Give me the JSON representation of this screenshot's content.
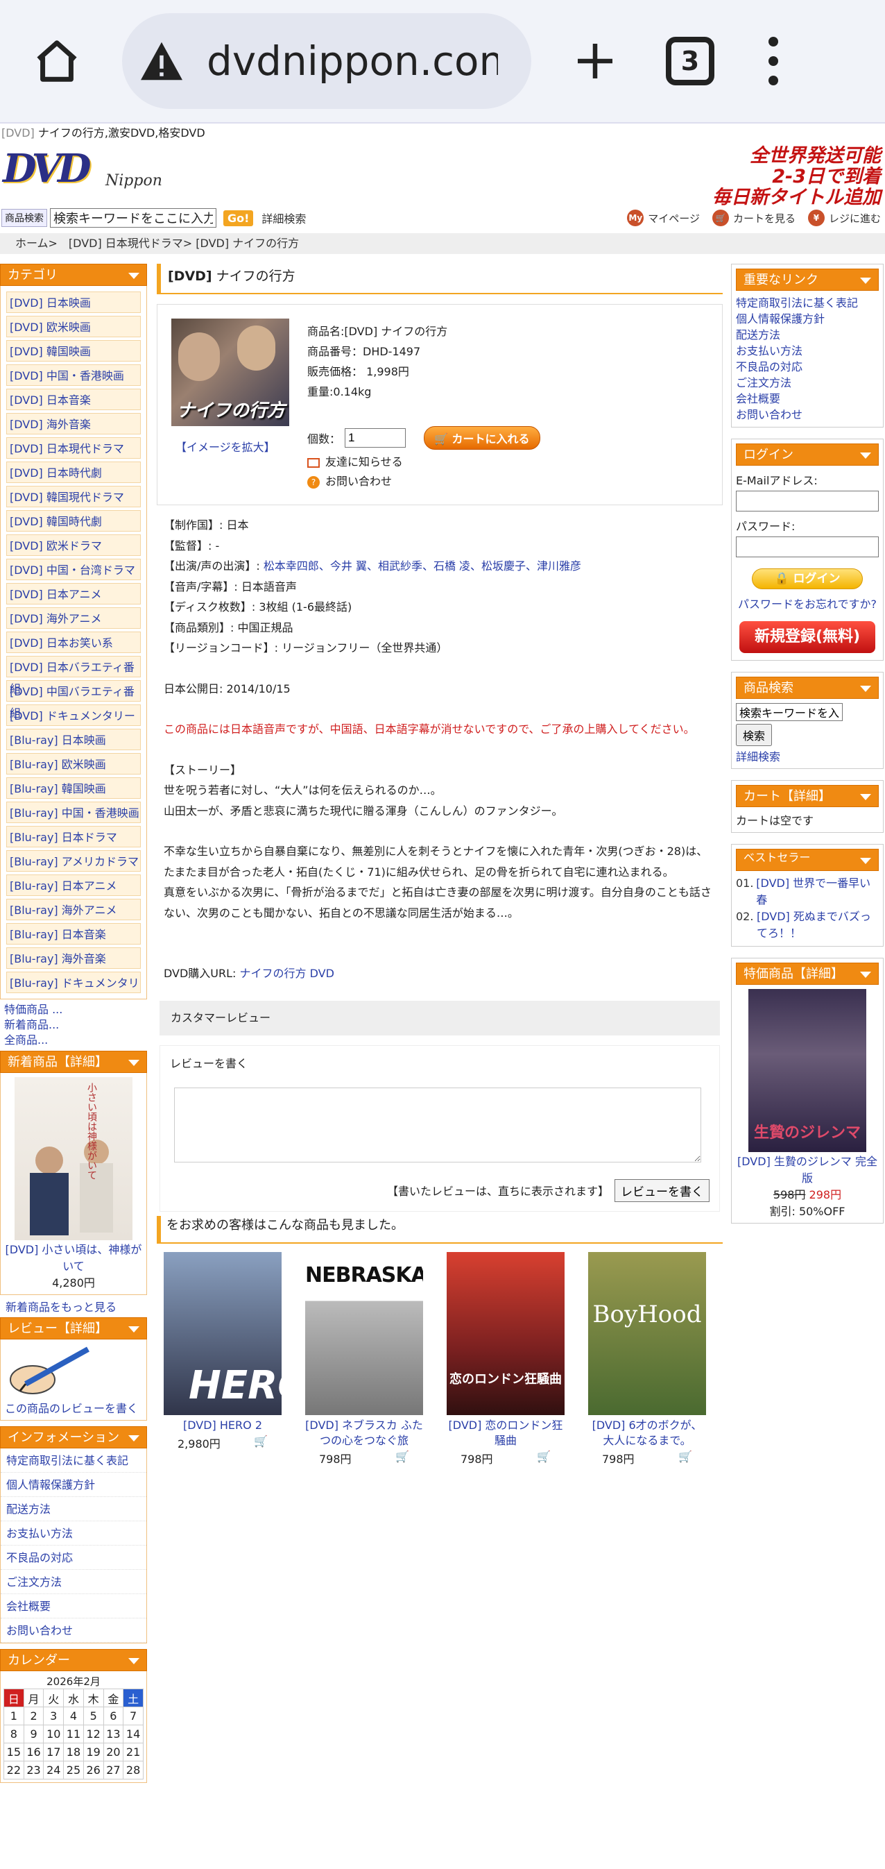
{
  "browser": {
    "url": "dvdnippon.com/",
    "tab_count": "3"
  },
  "page": {
    "tag": "[DVD]",
    "top_title": " ナイフの行方,激安DVD,格安DVD",
    "logo_big": "DVD",
    "logo_small": "Nippon",
    "promo": [
      "全世界発送可能",
      "2-3日で到着",
      "毎日新タイトル追加"
    ],
    "search_label": "商品検索",
    "search_placeholder": "検索キーワードをここに入力し",
    "go": "Go!",
    "advanced": "詳細検索",
    "toplinks": [
      "マイページ",
      "カートを見る",
      "レジに進む"
    ],
    "breadcrumb": "ホーム>　[DVD] 日本現代ドラマ> [DVD] ナイフの行方"
  },
  "left": {
    "category_title": "カテゴリ",
    "categories": [
      "[DVD] 日本映画",
      "[DVD] 欧米映画",
      "[DVD] 韓国映画",
      "[DVD] 中国・香港映画",
      "[DVD] 日本音楽",
      "[DVD] 海外音楽",
      "[DVD] 日本現代ドラマ",
      "[DVD] 日本時代劇",
      "[DVD] 韓国現代ドラマ",
      "[DVD] 韓国時代劇",
      "[DVD] 欧米ドラマ",
      "[DVD] 中国・台湾ドラマ",
      "[DVD] 日本アニメ",
      "[DVD] 海外アニメ",
      "[DVD] 日本お笑い系",
      "[DVD] 日本バラエティ番組",
      "[DVD] 中国バラエティ番組",
      "[DVD] ドキュメンタリー",
      "[Blu-ray] 日本映画",
      "[Blu-ray] 欧米映画",
      "[Blu-ray] 韓国映画",
      "[Blu-ray] 中国・香港映画",
      "[Blu-ray] 日本ドラマ",
      "[Blu-ray] アメリカドラマ",
      "[Blu-ray] 日本アニメ",
      "[Blu-ray] 海外アニメ",
      "[Blu-ray] 日本音楽",
      "[Blu-ray] 海外音楽",
      "[Blu-ray] ドキュメンタリ"
    ],
    "small_links": [
      "特価商品 ...",
      "新着商品...",
      "全商品..."
    ],
    "new_title": "新着商品【詳細】",
    "new_name": "[DVD] 小さい頃は、神様がいて",
    "new_price": "4,280円",
    "new_more": "新着商品をもっと見る",
    "review_title": "レビュー【詳細】",
    "review_link": "この商品のレビューを書く",
    "info_title": "インフォメーション",
    "info_links": [
      "特定商取引法に基く表記",
      "個人情報保護方針",
      "配送方法",
      "お支払い方法",
      "不良品の対応",
      "ご注文方法",
      "会社概要",
      "お問い合わせ"
    ],
    "calendar_title": "カレンダー",
    "calendar_month": "2026年2月",
    "calendar_days": [
      "日",
      "月",
      "火",
      "水",
      "木",
      "金",
      "土"
    ],
    "calendar_rows": [
      [
        "1",
        "2",
        "3",
        "4",
        "5",
        "6",
        "7"
      ],
      [
        "8",
        "9",
        "10",
        "11",
        "12",
        "13",
        "14"
      ],
      [
        "15",
        "16",
        "17",
        "18",
        "19",
        "20",
        "21"
      ],
      [
        "22",
        "23",
        "24",
        "25",
        "26",
        "27",
        "28"
      ]
    ]
  },
  "product": {
    "title_tag": "[DVD]",
    "title": " ナイフの行方",
    "image_text": "ナイフの行方",
    "enlarge": "【イメージを拡大】",
    "name": "商品名:[DVD] ナイフの行方",
    "number": "商品番号：DHD-1497",
    "price": "販売価格： 1,998円",
    "weight": "重量:0.14kg",
    "qty_label": "個数：",
    "qty_value": "1",
    "cart_button": "カートに入れる",
    "tell_friend": "友達に知らせる",
    "inquiry": "お問い合わせ"
  },
  "details": {
    "country": "【制作国】: 日本",
    "director": "【監督】: -",
    "cast_label": "【出演/声の出演】: ",
    "cast": "松本幸四郎、今井 翼、相武紗季、石橋 凌、松坂慶子、津川雅彦",
    "audio": "【音声/字幕】: 日本語音声",
    "discs": "【ディスク枚数】: 3枚組 (1-6最終話)",
    "type": "【商品類別】: 中国正規品",
    "region": "【リージョンコード】: リージョンフリー（全世界共通）",
    "release": "日本公開日: 2014/10/15",
    "warning": "この商品には日本語音声ですが、中国語、日本語字幕が消せないですので、ご了承の上購入してください。",
    "story_title": "【ストーリー】",
    "story1": "世を呪う若者に対し、“大人”は何を伝えられるのか…。",
    "story2": "山田太一が、矛盾と悲哀に満ちた現代に贈る渾身（こんしん）のファンタジー。",
    "story3": "不幸な生い立ちから自暴自棄になり、無差別に人を刺そうとナイフを懐に入れた青年・次男(つぎお・28)は、たまたま目が合った老人・拓自(たくじ・71)に組み伏せられ、足の骨を折られて自宅に連れ込まれる。",
    "story4": "真意をいぶかる次男に、「骨折が治るまでだ」と拓自は亡き妻の部屋を次男に明け渡す。自分自身のことも話さない、次男のことも聞かない、拓自との不思議な同居生活が始まる…。",
    "url_label": "DVD購入URL: ",
    "url_link": "ナイフの行方 DVD"
  },
  "review": {
    "header": "カスタマーレビュー",
    "write_label": "レビューを書く",
    "note": "【書いたレビューは、直ちに表示されます】",
    "button": "レビューを書く"
  },
  "also": {
    "title": "をお求めの客様はこんな商品も見ました。",
    "items": [
      {
        "name": "[DVD] HERO 2",
        "price": "2,980円",
        "cover": "HERO"
      },
      {
        "name": "[DVD] ネブラスカ ふたつの心をつなぐ旅",
        "price": "798円",
        "cover": "NEBRASKA"
      },
      {
        "name": "[DVD] 恋のロンドン狂騒曲",
        "price": "798円",
        "cover": "恋のロンドン狂騒曲"
      },
      {
        "name": "[DVD] 6才のボクが、大人になるまで。",
        "price": "798円",
        "cover": "BoyHood"
      }
    ]
  },
  "right": {
    "links_title": "重要なリンク",
    "links": [
      "特定商取引法に基く表記",
      "個人情報保護方針",
      "配送方法",
      "お支払い方法",
      "不良品の対応",
      "ご注文方法",
      "会社概要",
      "お問い合わせ"
    ],
    "login_title": "ログイン",
    "email_label": "E-Mailアドレス:",
    "password_label": "パスワード:",
    "login_button": "ログイン",
    "forgot": "パスワードをお忘れですか?",
    "register": "新規登録(無料)",
    "search_title": "商品検索",
    "search_placeholder": "検索キーワードを入",
    "search_button": "検索",
    "advanced": "詳細検索",
    "cart_title": "カート【詳細】",
    "cart_empty": "カートは空です",
    "best_title": "ベストセラー",
    "best": [
      {
        "n": "01.",
        "t": "[DVD] 世界で一番早い春"
      },
      {
        "n": "02.",
        "t": "[DVD] 死ぬまでバズってろ！！"
      }
    ],
    "special_title": "特価商品【詳細】",
    "special_cover": "生贄のジレンマ",
    "special_name": "[DVD] 生贄のジレンマ 完全版",
    "special_old": "598円",
    "special_new": "298円",
    "special_discount": "割引: 50%OFF"
  }
}
